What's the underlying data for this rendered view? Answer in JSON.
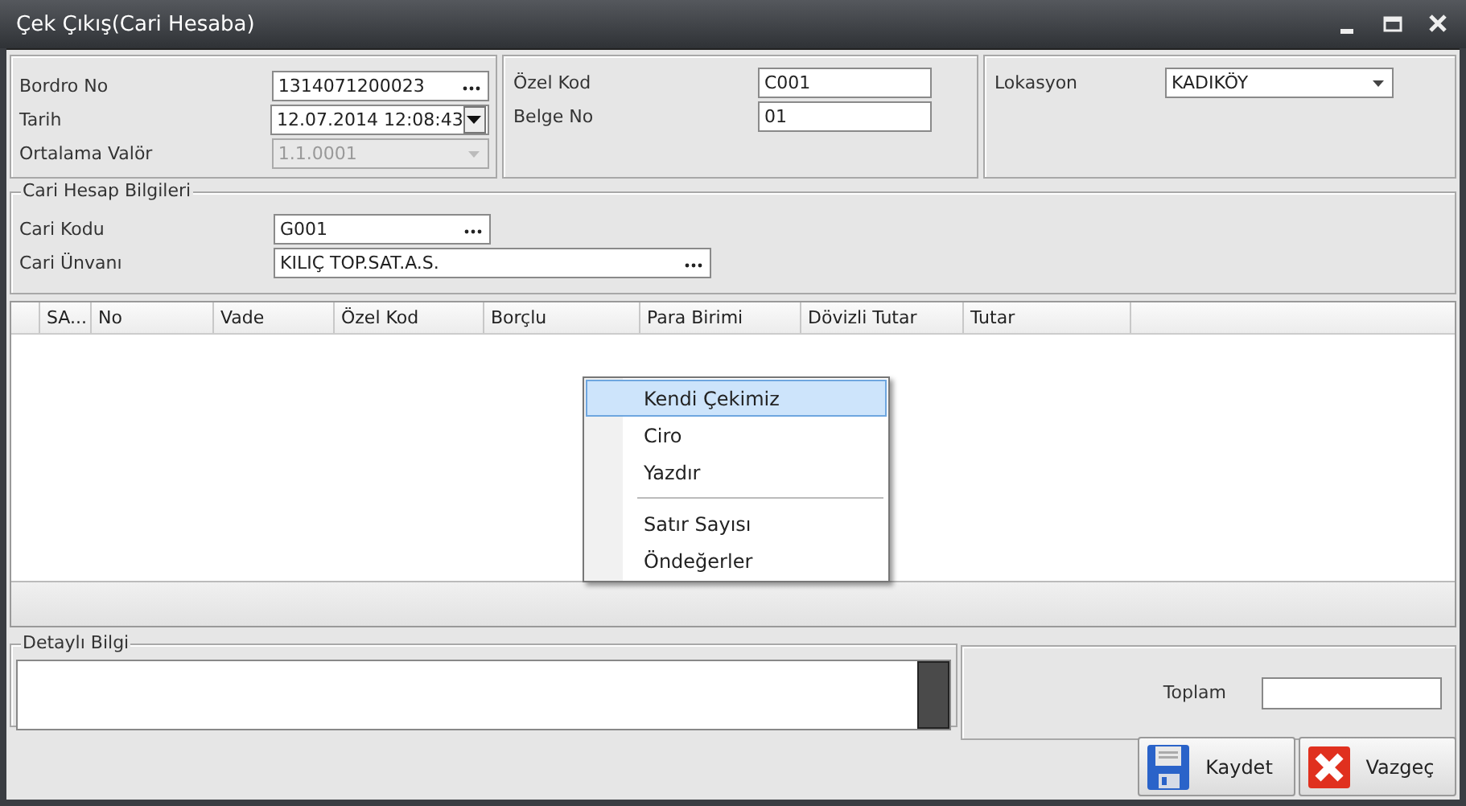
{
  "window": {
    "title": "Çek Çıkış(Cari Hesaba)"
  },
  "header": {
    "left": [
      {
        "label": "Bordro No",
        "kind": "lookup",
        "value": "1314071200023",
        "disabled": false
      },
      {
        "label": "Tarih",
        "kind": "date",
        "value": "12.07.2014 12:08:43",
        "disabled": false
      },
      {
        "label": "Ortalama Valör",
        "kind": "combo",
        "value": "1.1.0001",
        "disabled": true
      }
    ],
    "middle": [
      {
        "label": "Özel Kod",
        "value": "C001",
        "disabled": false
      },
      {
        "label": "Belge No",
        "value": "01",
        "disabled": false
      }
    ],
    "right": [
      {
        "label": "Lokasyon",
        "kind": "combo",
        "value": "KADIKÖY",
        "disabled": false
      }
    ]
  },
  "account": {
    "title": "Cari Hesap Bilgileri",
    "fields": [
      {
        "label": "Cari Kodu",
        "kind": "lookup",
        "value": "G001",
        "disabled": false
      },
      {
        "label": "Cari Ünvanı",
        "kind": "lookup",
        "value": "KILIÇ TOP.SAT.A.S.",
        "disabled": false
      }
    ]
  },
  "table": {
    "columns": [
      "SA...",
      "No",
      "Vade",
      "Özel Kod",
      "Borçlu",
      "Para Birimi",
      "Dövizli Tutar",
      "Tutar"
    ]
  },
  "context_menu": {
    "items": [
      {
        "kind": "item",
        "label": "Kendi Çekimiz",
        "selected": true
      },
      {
        "kind": "item",
        "label": "Ciro",
        "selected": false
      },
      {
        "kind": "item",
        "label": "Yazdır",
        "selected": false
      },
      {
        "kind": "separator"
      },
      {
        "kind": "item",
        "label": "Satır Sayısı",
        "selected": false
      },
      {
        "kind": "item",
        "label": "Öndeğerler",
        "selected": false
      }
    ]
  },
  "details": {
    "title": "Detaylı Bilgi"
  },
  "total": {
    "label": "Toplam"
  },
  "buttons": [
    {
      "kind": "save",
      "label": "Kaydet"
    },
    {
      "kind": "cancel",
      "label": "Vazgeç"
    }
  ]
}
